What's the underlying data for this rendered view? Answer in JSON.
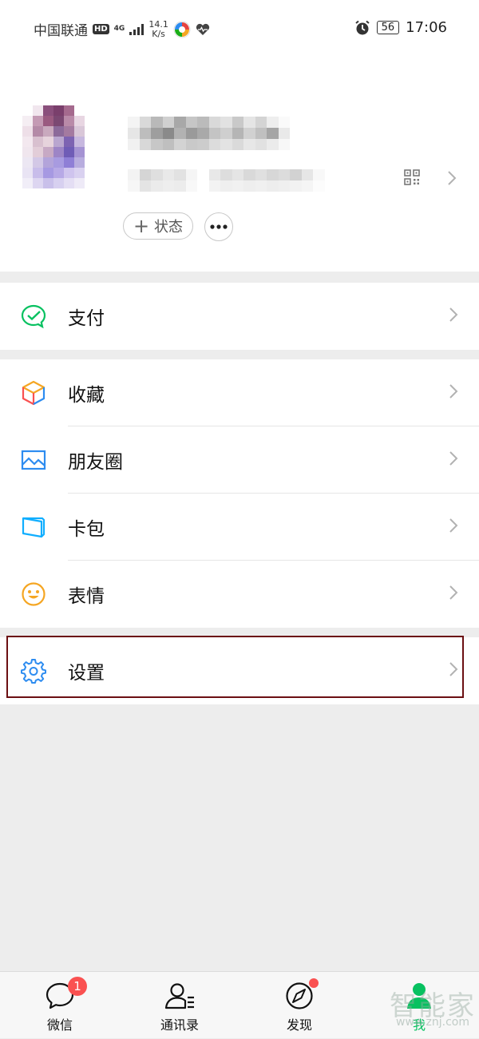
{
  "status_bar": {
    "carrier": "中国联通",
    "hd": "HD",
    "network": "4G",
    "speed_value": "14.1",
    "speed_unit": "K/s",
    "battery": "56",
    "time": "17:06"
  },
  "profile": {
    "status_button": "状态",
    "plus_symbol": "+"
  },
  "menu": {
    "pay": "支付",
    "favorites": "收藏",
    "moments": "朋友圈",
    "cards": "卡包",
    "stickers": "表情",
    "settings": "设置"
  },
  "tabbar": {
    "chats": "微信",
    "chats_badge": "1",
    "contacts": "通讯录",
    "discover": "发现",
    "me": "我"
  },
  "watermark": {
    "text": "智能家",
    "url": "www.znj.com"
  },
  "colors": {
    "green": "#07c160",
    "badge_red": "#fa5151",
    "highlight_border": "#6b0f12",
    "background": "#ededed"
  }
}
